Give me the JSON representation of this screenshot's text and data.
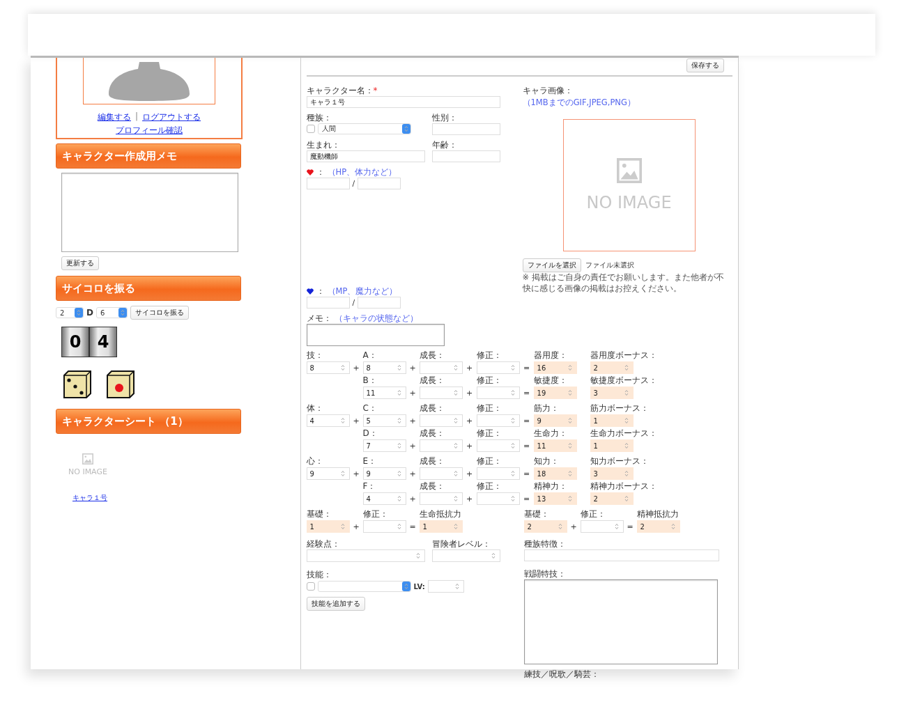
{
  "sidebar": {
    "links": [
      {
        "label": "編集する"
      },
      {
        "label": "ログアウトする"
      },
      {
        "label": "プロフィール確認"
      }
    ],
    "link_separator": "|",
    "memo": {
      "heading": "キャラクター作成用メモ",
      "button": "更新する"
    },
    "dice": {
      "heading": "サイコロを振る",
      "count": "2",
      "d_label": "D",
      "sides": "6",
      "button": "サイコロを振る",
      "counter": [
        "0",
        "4"
      ],
      "dice": [
        {
          "kind": "three"
        },
        {
          "kind": "one"
        }
      ]
    },
    "sheets": {
      "heading": "キャラクターシート （1）",
      "items": [
        {
          "no_image": "NO IMAGE",
          "name": "キャラ１号"
        }
      ]
    }
  },
  "form": {
    "save_button": "保存する",
    "name": {
      "label": "キャラクター名：",
      "required_mark": "*",
      "value": "キャラ１号"
    },
    "race": {
      "label": "種族：",
      "checked": false,
      "value": "人間"
    },
    "gender": {
      "label": "性別："
    },
    "birth": {
      "label": "生まれ：",
      "value": "魔動機師"
    },
    "age": {
      "label": "年齢："
    },
    "gauges": [
      {
        "color": "#e8141c",
        "label": "：",
        "hint": "（HP、体力など）",
        "separator": "/"
      },
      {
        "color": "#1424d8",
        "label": "：",
        "hint": "（MP、魔力など）",
        "separator": "/"
      }
    ],
    "memo": {
      "label": "メモ：",
      "hint": "（キャラの状態など）"
    },
    "image": {
      "label": "キャラ画像：",
      "hint": "（1MBまでのGIF,JPEG,PNG）",
      "no_image": "NO IMAGE",
      "file_button": "ファイルを選択",
      "file_status": "ファイル未選択",
      "notice": "※ 掲載はご自身の責任でお願いします。また他者が不快に感じる画像の掲載はお控えください。"
    },
    "stats": [
      {
        "label": "技：",
        "value": "8",
        "rows": [
          {
            "sub_label": "A：",
            "sub_value": "8",
            "growth_label": "成長：",
            "mod_label": "修正：",
            "result_label": "器用度：",
            "result": "16",
            "bonus_label": "器用度ボーナス：",
            "bonus": "2",
            "ops": [
              "+",
              "+",
              "+",
              "="
            ]
          },
          {
            "sub_label": "B：",
            "sub_value": "11",
            "growth_label": "成長：",
            "mod_label": "修正：",
            "result_label": "敏捷度：",
            "result": "19",
            "bonus_label": "敏捷度ボーナス：",
            "bonus": "3",
            "ops": [
              "+",
              "+",
              "="
            ]
          }
        ]
      },
      {
        "label": "体：",
        "value": "4",
        "rows": [
          {
            "sub_label": "C：",
            "sub_value": "5",
            "growth_label": "成長：",
            "mod_label": "修正：",
            "result_label": "筋力：",
            "result": "9",
            "bonus_label": "筋力ボーナス：",
            "bonus": "1",
            "ops": [
              "+",
              "+",
              "+",
              "="
            ]
          },
          {
            "sub_label": "D：",
            "sub_value": "7",
            "growth_label": "成長：",
            "mod_label": "修正：",
            "result_label": "生命力：",
            "result": "11",
            "bonus_label": "生命力ボーナス：",
            "bonus": "1",
            "ops": [
              "+",
              "+",
              "="
            ]
          }
        ]
      },
      {
        "label": "心：",
        "value": "9",
        "rows": [
          {
            "sub_label": "E：",
            "sub_value": "9",
            "growth_label": "成長：",
            "mod_label": "修正：",
            "result_label": "知力：",
            "result": "18",
            "bonus_label": "知力ボーナス：",
            "bonus": "3",
            "ops": [
              "+",
              "+",
              "+",
              "="
            ]
          },
          {
            "sub_label": "F：",
            "sub_value": "4",
            "growth_label": "成長：",
            "mod_label": "修正：",
            "result_label": "精神力：",
            "result": "13",
            "bonus_label": "精神力ボーナス：",
            "bonus": "2",
            "ops": [
              "+",
              "+",
              "="
            ]
          }
        ]
      }
    ],
    "resists": [
      {
        "base_label": "基礎：",
        "base": "1",
        "mod_label": "修正：",
        "result_label": "生命抵抗力",
        "result": "1",
        "ops": [
          "+",
          "="
        ]
      },
      {
        "base_label": "基礎：",
        "base": "2",
        "mod_label": "修正：",
        "result_label": "精神抵抗力",
        "result": "2",
        "ops": [
          "+",
          "="
        ]
      }
    ],
    "exp": {
      "label": "経験点："
    },
    "adventurer_level": {
      "label": "冒険者レベル："
    },
    "race_traits": {
      "label": "種族特徴："
    },
    "skills": {
      "label": "技能：",
      "checked": false,
      "lv_label": "LV:",
      "add_button": "技能を追加する"
    },
    "combat_feats": {
      "label": "戦闘特技："
    },
    "next_label": "練技／呪歌／騎芸："
  }
}
